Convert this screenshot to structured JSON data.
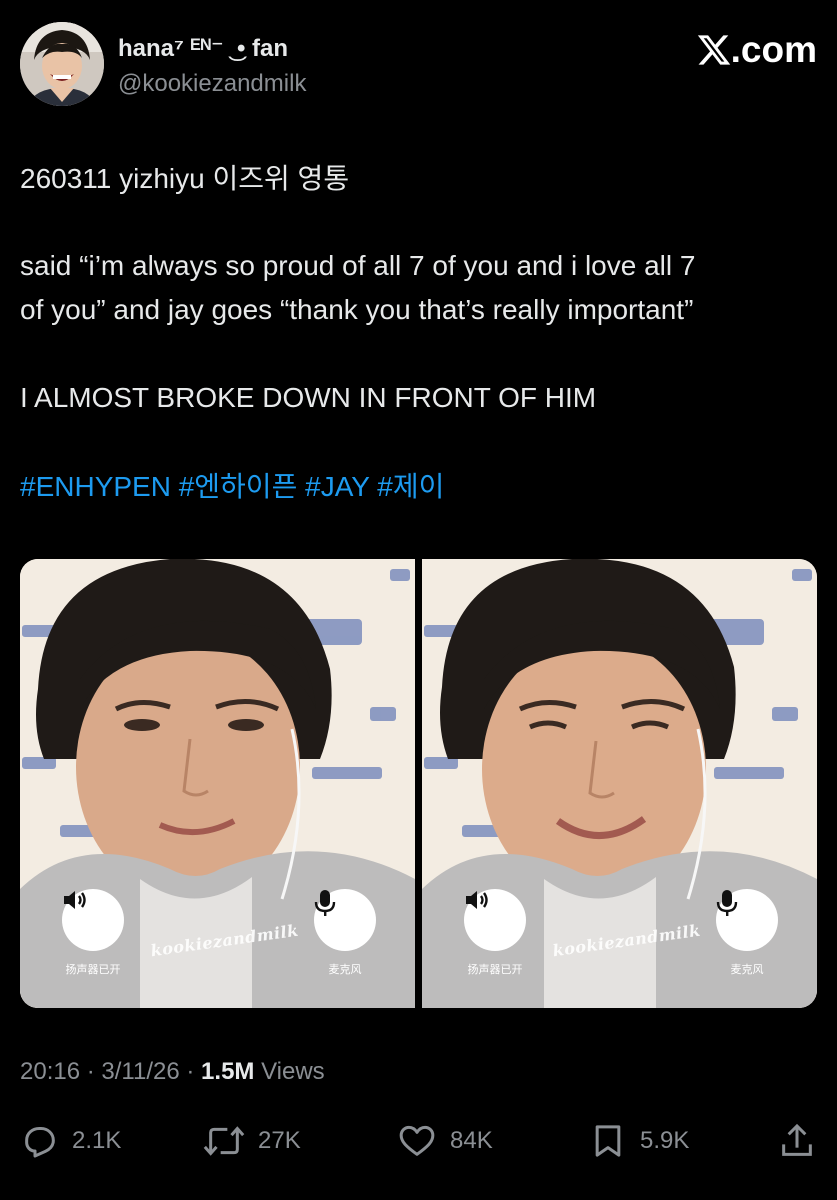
{
  "author": {
    "display_name": "hana⁷ ᴱᴺ⁻ ͜ • fan",
    "handle": "@kookiezandmilk",
    "avatar_icon": "avatar-photo"
  },
  "brand": {
    "label": ".com"
  },
  "tweet": {
    "line1": "260311 yizhiyu 이즈위 영통",
    "line2": "said “i’m always so proud of all 7 of you and i love all 7",
    "line3": "of you” and jay goes “thank you that’s really important”",
    "line4": "I ALMOST BROKE DOWN IN FRONT OF HIM",
    "hashtags": [
      "#ENHYPEN",
      "#엔하이픈",
      "#JAY",
      "#제이"
    ]
  },
  "media": [
    {
      "watermark": "kookiezandmilk",
      "speaker_label": "扬声器已开",
      "mic_label": "麦克风"
    },
    {
      "watermark": "kookiezandmilk",
      "speaker_label": "扬声器已开",
      "mic_label": "麦克风"
    }
  ],
  "meta": {
    "time": "20:16",
    "date": "3/11/26",
    "separator": "·",
    "views_count": "1.5M",
    "views_label": "Views"
  },
  "actions": {
    "replies": "2.1K",
    "reposts": "27K",
    "likes": "84K",
    "bookmarks": "5.9K"
  },
  "colors": {
    "background": "#000000",
    "text": "#e7e9ea",
    "muted": "#8b8f94",
    "hashtag": "#1d9bf0"
  }
}
